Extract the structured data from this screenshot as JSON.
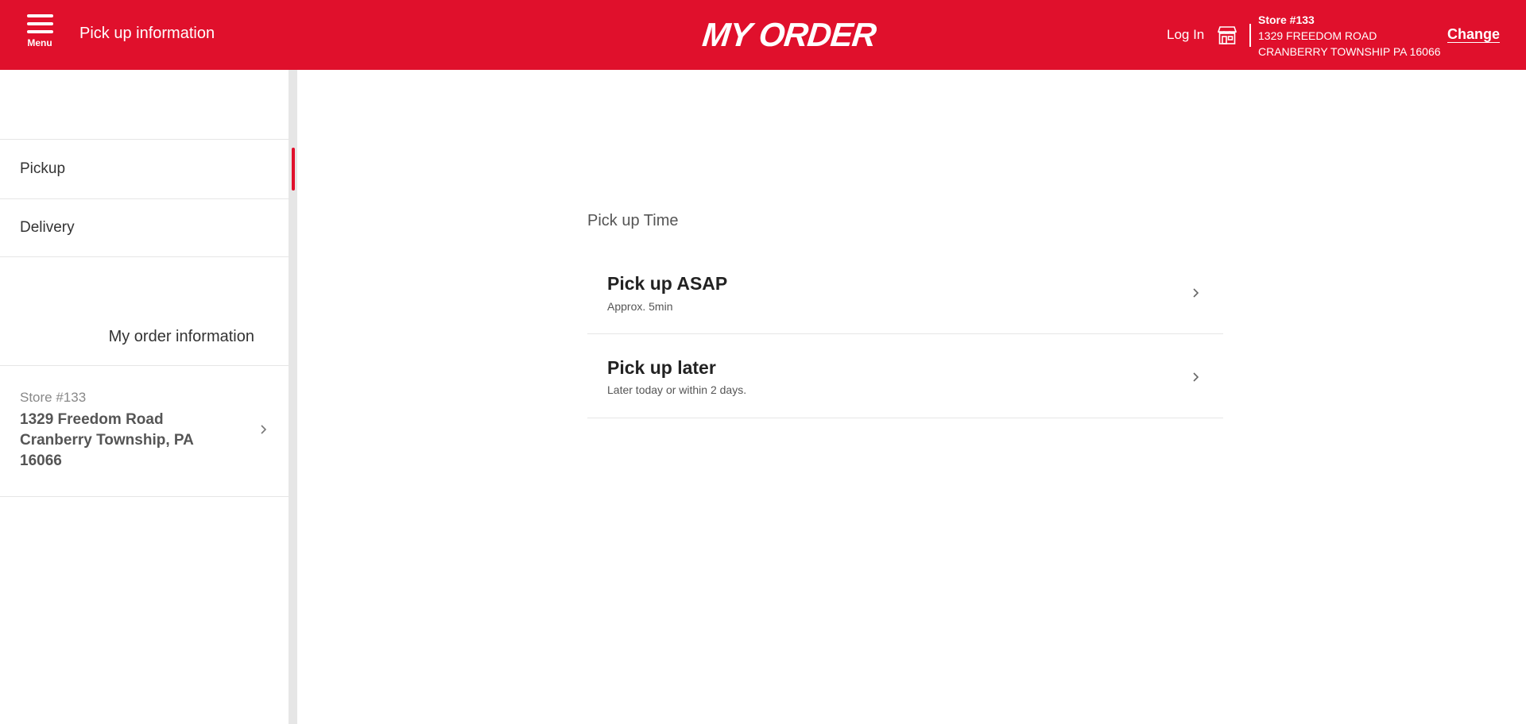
{
  "header": {
    "menu_label": "Menu",
    "page_title": "Pick up information",
    "logo_text": "MY ORDER",
    "login_label": "Log In",
    "store": {
      "number": "Store #133",
      "address_line1": "1329 FREEDOM ROAD",
      "address_line2": "CRANBERRY TOWNSHIP PA 16066"
    },
    "change_label": "Change"
  },
  "sidebar": {
    "items": [
      {
        "label": "Pickup",
        "active": true
      },
      {
        "label": "Delivery",
        "active": false
      }
    ],
    "order_info_label": "My order information",
    "store_card": {
      "number": "Store #133",
      "address": "1329 Freedom Road Cranberry Township, PA 16066"
    }
  },
  "main": {
    "section_title": "Pick up Time",
    "options": [
      {
        "title": "Pick up ASAP",
        "subtitle": "Approx. 5min"
      },
      {
        "title": "Pick up later",
        "subtitle": "Later today or within 2 days."
      }
    ]
  },
  "colors": {
    "brand_red": "#e0102c",
    "divider": "#e6e6e6"
  },
  "icons": {
    "menu": "hamburger-icon",
    "store": "store-icon",
    "chevron": "chevron-right-icon"
  }
}
